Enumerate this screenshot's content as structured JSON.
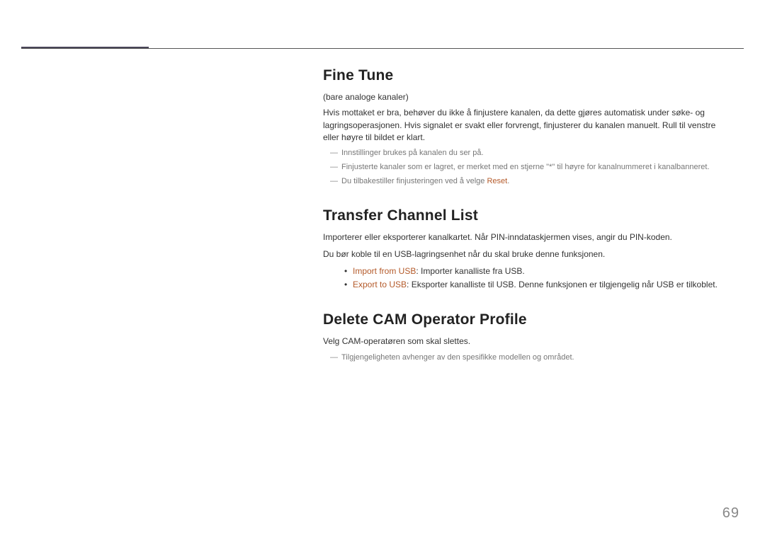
{
  "page_number": "69",
  "sections": {
    "fine_tune": {
      "heading": "Fine Tune",
      "sub": "(bare analoge kanaler)",
      "body": "Hvis mottaket er bra, behøver du ikke å finjustere kanalen, da dette gjøres automatisk under søke- og lagringsoperasjonen. Hvis signalet er svakt eller forvrengt, finjusterer du kanalen manuelt. Rull til venstre eller høyre til bildet er klart.",
      "notes": {
        "n1": "Innstillinger brukes på kanalen du ser på.",
        "n2": "Finjusterte kanaler som er lagret, er merket med en stjerne \"*\" til høyre for kanalnummeret i kanalbanneret.",
        "n3_pre": "Du tilbakestiller finjusteringen ved å velge ",
        "n3_hl": "Reset",
        "n3_post": "."
      }
    },
    "transfer": {
      "heading": "Transfer Channel List",
      "body1": "Importerer eller eksporterer kanalkartet. Når PIN-inndataskjermen vises, angir du PIN-koden.",
      "body2": "Du bør koble til en USB-lagringsenhet når du skal bruke denne funksjonen.",
      "bullets": {
        "b1_hl": "Import from USB",
        "b1_rest": ": Importer kanalliste fra USB.",
        "b2_hl": "Export to USB",
        "b2_rest": ": Eksporter kanalliste til USB. Denne funksjonen er tilgjengelig når USB er tilkoblet."
      }
    },
    "delete_cam": {
      "heading": "Delete CAM Operator Profile",
      "body": "Velg CAM-operatøren som skal slettes.",
      "note": "Tilgjengeligheten avhenger av den spesifikke modellen og området."
    }
  }
}
